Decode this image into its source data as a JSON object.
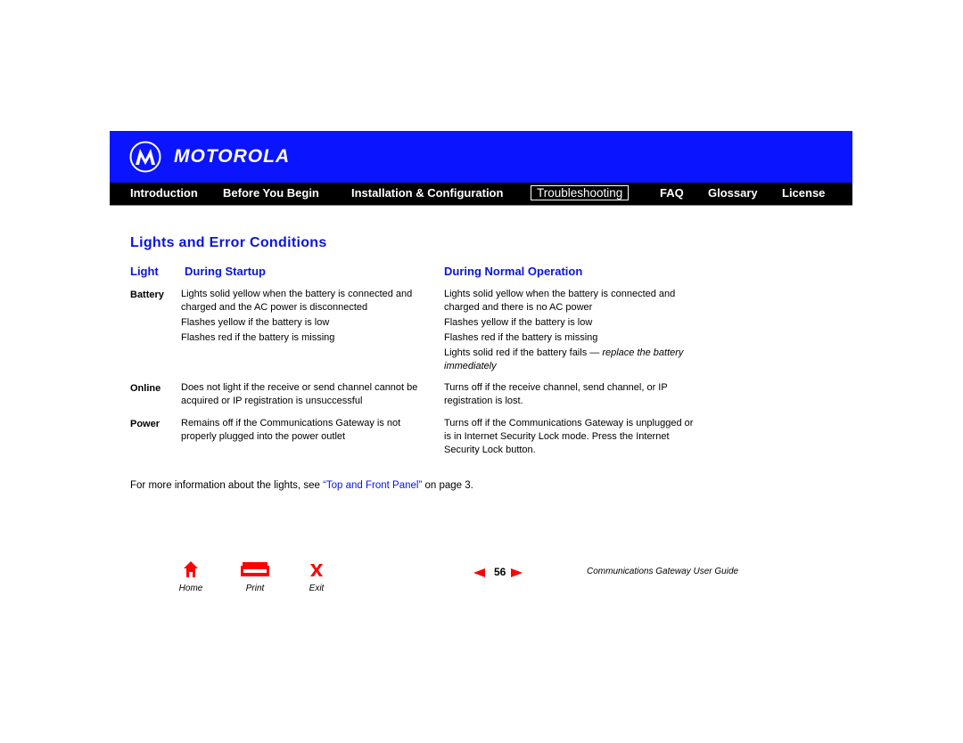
{
  "header": {
    "brand": "MOTOROLA",
    "logo_icon": "motorola-batwing-icon",
    "nav": [
      {
        "label": "Introduction",
        "active": false
      },
      {
        "label": "Before You Begin",
        "active": false
      },
      {
        "label": "Installation & Configuration",
        "active": false
      },
      {
        "label": "Troubleshooting",
        "active": true
      },
      {
        "label": "FAQ",
        "active": false
      },
      {
        "label": "Glossary",
        "active": false
      },
      {
        "label": "License",
        "active": false
      }
    ]
  },
  "page": {
    "title": "Lights and Error Conditions",
    "columns": [
      "Light",
      "During Startup",
      "During Normal Operation"
    ],
    "rows": [
      {
        "light": "Battery",
        "startup": [
          "Lights solid yellow when the battery is connected and charged and the AC power is disconnected",
          "Flashes yellow if the battery is low",
          "Flashes red if the battery is missing"
        ],
        "normal": [
          "Lights solid yellow when the battery is connected and charged and there is no AC power",
          "Flashes yellow if the battery is low",
          "Flashes red if the battery is missing"
        ],
        "normal_last_plain": "Lights solid red if the battery fails — ",
        "normal_last_italic": "replace the battery immediately"
      },
      {
        "light": "Online",
        "startup": [
          "Does not light if the receive or send channel cannot be acquired or IP registration is unsuccessful"
        ],
        "normal": [
          "Turns off if the receive channel, send channel, or IP registration is lost."
        ]
      },
      {
        "light": "Power",
        "startup": [
          "Remains off if the Communications Gateway is not properly plugged into the power outlet"
        ],
        "normal": [
          "Turns off if the Communications Gateway is unplugged or is in Internet Security Lock mode. Press the Internet Security Lock button."
        ]
      }
    ],
    "note_prefix": "For more information about the lights, see ",
    "note_link": "“Top and Front Panel”",
    "note_suffix": " on page 3."
  },
  "footer": {
    "home_label": "Home",
    "print_label": "Print",
    "exit_label": "Exit",
    "page_number": "56",
    "guide_title": "Communications Gateway User Guide",
    "accent_color": "#ff0000"
  }
}
